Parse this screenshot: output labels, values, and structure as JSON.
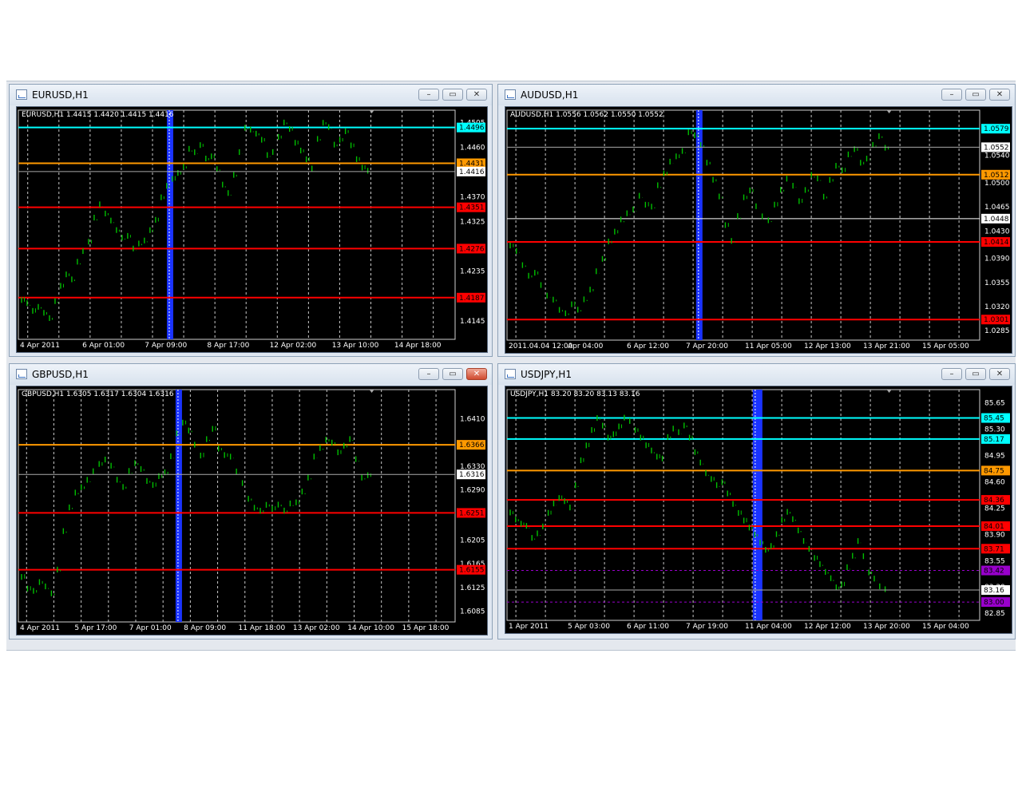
{
  "windows": [
    {
      "id": "eurusd",
      "title": "EURUSD,H1",
      "info": "EURUSD,H1  1.4415 1.4420 1.4415 1.4416",
      "ylim": [
        1.412,
        1.451
      ],
      "yticks": [
        "1.4505",
        "1.4460",
        "1.4370",
        "1.4325",
        "1.4235",
        "1.4145"
      ],
      "xticks": [
        "4 Apr 2011",
        "6 Apr 01:00",
        "7 Apr 09:00",
        "8 Apr 17:00",
        "12 Apr 02:00",
        "13 Apr 10:00",
        "14 Apr 18:00"
      ],
      "hlines": [
        {
          "value": 1.4496,
          "label": "1.4496",
          "color": "#00ffff"
        },
        {
          "value": 1.4431,
          "label": "1.4431",
          "color": "#ff9900"
        },
        {
          "value": 1.4351,
          "label": "1.4351",
          "color": "#ff0000"
        },
        {
          "value": 1.4276,
          "label": "1.4276",
          "color": "#ff0000"
        },
        {
          "value": 1.4187,
          "label": "1.4187",
          "color": "#ff0000"
        }
      ],
      "current": {
        "value": 1.4416,
        "label": "1.4416"
      },
      "series": [
        1.4185,
        1.4175,
        1.4165,
        1.417,
        1.416,
        1.415,
        1.418,
        1.421,
        1.423,
        1.422,
        1.425,
        1.427,
        1.429,
        1.433,
        1.4355,
        1.434,
        1.4325,
        1.431,
        1.4295,
        1.43,
        1.4275,
        1.4285,
        1.429,
        1.431,
        1.433,
        1.437,
        1.439,
        1.4405,
        1.4415,
        1.4425,
        1.4455,
        1.445,
        1.4465,
        1.444,
        1.4445,
        1.442,
        1.439,
        1.4375,
        1.441,
        1.445,
        1.4495,
        1.449,
        1.4485,
        1.4475,
        1.4445,
        1.445,
        1.448,
        1.4505,
        1.4495,
        1.447,
        1.4455,
        1.444,
        1.442,
        1.4475,
        1.4505,
        1.4495,
        1.4465,
        1.4475,
        1.449,
        1.4465,
        1.444,
        1.4425,
        1.4416
      ]
    },
    {
      "id": "audusd",
      "title": "AUDUSD,H1",
      "info": "AUDUSD,H1  1.0556 1.0562 1.0550 1.0552",
      "ylim": [
        1.0278,
        1.0592
      ],
      "yticks": [
        "1.0540",
        "1.0500",
        "1.0465",
        "1.0430",
        "1.0390",
        "1.0355",
        "1.0320",
        "1.0285"
      ],
      "xticks": [
        "2011.04.04 12:00",
        "Apr 04:00",
        "6 Apr 12:00",
        "7 Apr 20:00",
        "11 Apr 05:00",
        "12 Apr 13:00",
        "13 Apr 21:00",
        "15 Apr 05:00"
      ],
      "hlines": [
        {
          "value": 1.0579,
          "label": "1.0579",
          "color": "#00ffff"
        },
        {
          "value": 1.0512,
          "label": "1.0512",
          "color": "#ff9900"
        },
        {
          "value": 1.0414,
          "label": "1.0414",
          "color": "#ff0000"
        },
        {
          "value": 1.0301,
          "label": "1.0301",
          "color": "#ff0000"
        }
      ],
      "current": {
        "value": 1.0552,
        "label": "1.0552"
      },
      "extra_line": {
        "value": 1.0448,
        "label": "1.0448"
      },
      "series": [
        1.041,
        1.04,
        1.038,
        1.0365,
        1.037,
        1.035,
        1.0335,
        1.033,
        1.0315,
        1.031,
        1.0325,
        1.0315,
        1.033,
        1.0345,
        1.037,
        1.039,
        1.0415,
        1.043,
        1.0445,
        1.0455,
        1.046,
        1.048,
        1.047,
        1.0465,
        1.0495,
        1.0515,
        1.053,
        1.054,
        1.0545,
        1.0575,
        1.057,
        1.0555,
        1.053,
        1.0505,
        1.048,
        1.044,
        1.0415,
        1.045,
        1.048,
        1.049,
        1.0465,
        1.045,
        1.0445,
        1.047,
        1.049,
        1.0505,
        1.0495,
        1.0475,
        1.049,
        1.051,
        1.0505,
        1.048,
        1.0505,
        1.0525,
        1.052,
        1.054,
        1.055,
        1.053,
        1.0535,
        1.0555,
        1.0568,
        1.0552
      ]
    },
    {
      "id": "gbpusd",
      "title": "GBPUSD,H1",
      "info": "GBPUSD,H1  1.6305 1.6317 1.6304 1.6316",
      "ylim": [
        1.6075,
        1.6443
      ],
      "yticks": [
        "1.6410",
        "1.6330",
        "1.6290",
        "1.6205",
        "1.6165",
        "1.6125",
        "1.6085"
      ],
      "xticks": [
        "4 Apr 2011",
        "5 Apr 17:00",
        "7 Apr 01:00",
        "8 Apr 09:00",
        "11 Apr 18:00",
        "13 Apr 02:00",
        "14 Apr 10:00",
        "15 Apr 18:00"
      ],
      "hlines": [
        {
          "value": 1.6366,
          "label": "1.6366",
          "color": "#ff9900"
        },
        {
          "value": 1.6251,
          "label": "1.6251",
          "color": "#ff0000"
        },
        {
          "value": 1.6155,
          "label": "1.6155",
          "color": "#ff0000"
        }
      ],
      "current": {
        "value": 1.6316,
        "label": "1.6316"
      },
      "series": [
        1.6145,
        1.6125,
        1.612,
        1.6135,
        1.6125,
        1.6115,
        1.6155,
        1.622,
        1.626,
        1.6285,
        1.6295,
        1.6305,
        1.632,
        1.6335,
        1.634,
        1.633,
        1.6305,
        1.6295,
        1.632,
        1.6335,
        1.6325,
        1.6305,
        1.63,
        1.6315,
        1.632,
        1.6345,
        1.6385,
        1.6405,
        1.639,
        1.6365,
        1.635,
        1.6375,
        1.6395,
        1.636,
        1.635,
        1.6345,
        1.632,
        1.63,
        1.6275,
        1.626,
        1.6255,
        1.6265,
        1.626,
        1.6265,
        1.6255,
        1.6265,
        1.627,
        1.6285,
        1.631,
        1.6345,
        1.636,
        1.6375,
        1.637,
        1.6355,
        1.6365,
        1.6375,
        1.634,
        1.631,
        1.6316
      ]
    },
    {
      "id": "usdjpy",
      "title": "USDJPY,H1",
      "info": "USDJPY,H1  83.20 83.20 83.13 83.16",
      "ylim": [
        82.82,
        85.7
      ],
      "yticks": [
        "85.65",
        "85.30",
        "84.95",
        "84.60",
        "84.25",
        "83.90",
        "83.55",
        "83.20",
        "82.85"
      ],
      "xticks": [
        "1 Apr 2011",
        "5 Apr 03:00",
        "6 Apr 11:00",
        "7 Apr 19:00",
        "11 Apr 04:00",
        "12 Apr 12:00",
        "13 Apr 20:00",
        "15 Apr 04:00"
      ],
      "hlines": [
        {
          "value": 85.45,
          "label": "85.45",
          "color": "#00ffff"
        },
        {
          "value": 85.17,
          "label": "85.17",
          "color": "#00ffff"
        },
        {
          "value": 84.75,
          "label": "84.75",
          "color": "#ff9900"
        },
        {
          "value": 84.36,
          "label": "84.36",
          "color": "#ff0000"
        },
        {
          "value": 84.01,
          "label": "84.01",
          "color": "#ff0000"
        },
        {
          "value": 83.71,
          "label": "83.71",
          "color": "#ff0000"
        }
      ],
      "dotted": [
        {
          "value": 83.42,
          "label": "83.42",
          "color": "#9900cc"
        },
        {
          "value": 83.0,
          "label": "83.00",
          "color": "#9900cc"
        }
      ],
      "current": {
        "value": 83.16,
        "label": "83.16"
      },
      "series": [
        84.2,
        84.1,
        84.05,
        84.0,
        83.85,
        83.9,
        84.0,
        84.2,
        84.3,
        84.4,
        84.35,
        84.25,
        84.55,
        84.9,
        85.1,
        85.3,
        85.45,
        85.35,
        85.2,
        85.25,
        85.35,
        85.45,
        85.4,
        85.3,
        85.2,
        85.1,
        85.0,
        84.95,
        84.9,
        85.2,
        85.3,
        85.25,
        85.35,
        85.2,
        85.0,
        84.85,
        84.7,
        84.65,
        84.55,
        84.6,
        84.45,
        84.3,
        84.2,
        84.1,
        84.0,
        83.9,
        83.8,
        83.7,
        83.75,
        83.9,
        84.1,
        84.2,
        84.1,
        83.95,
        83.8,
        83.7,
        83.6,
        83.5,
        83.4,
        83.3,
        83.2,
        83.25,
        83.45,
        83.6,
        83.8,
        83.6,
        83.4,
        83.3,
        83.2,
        83.16
      ]
    }
  ]
}
